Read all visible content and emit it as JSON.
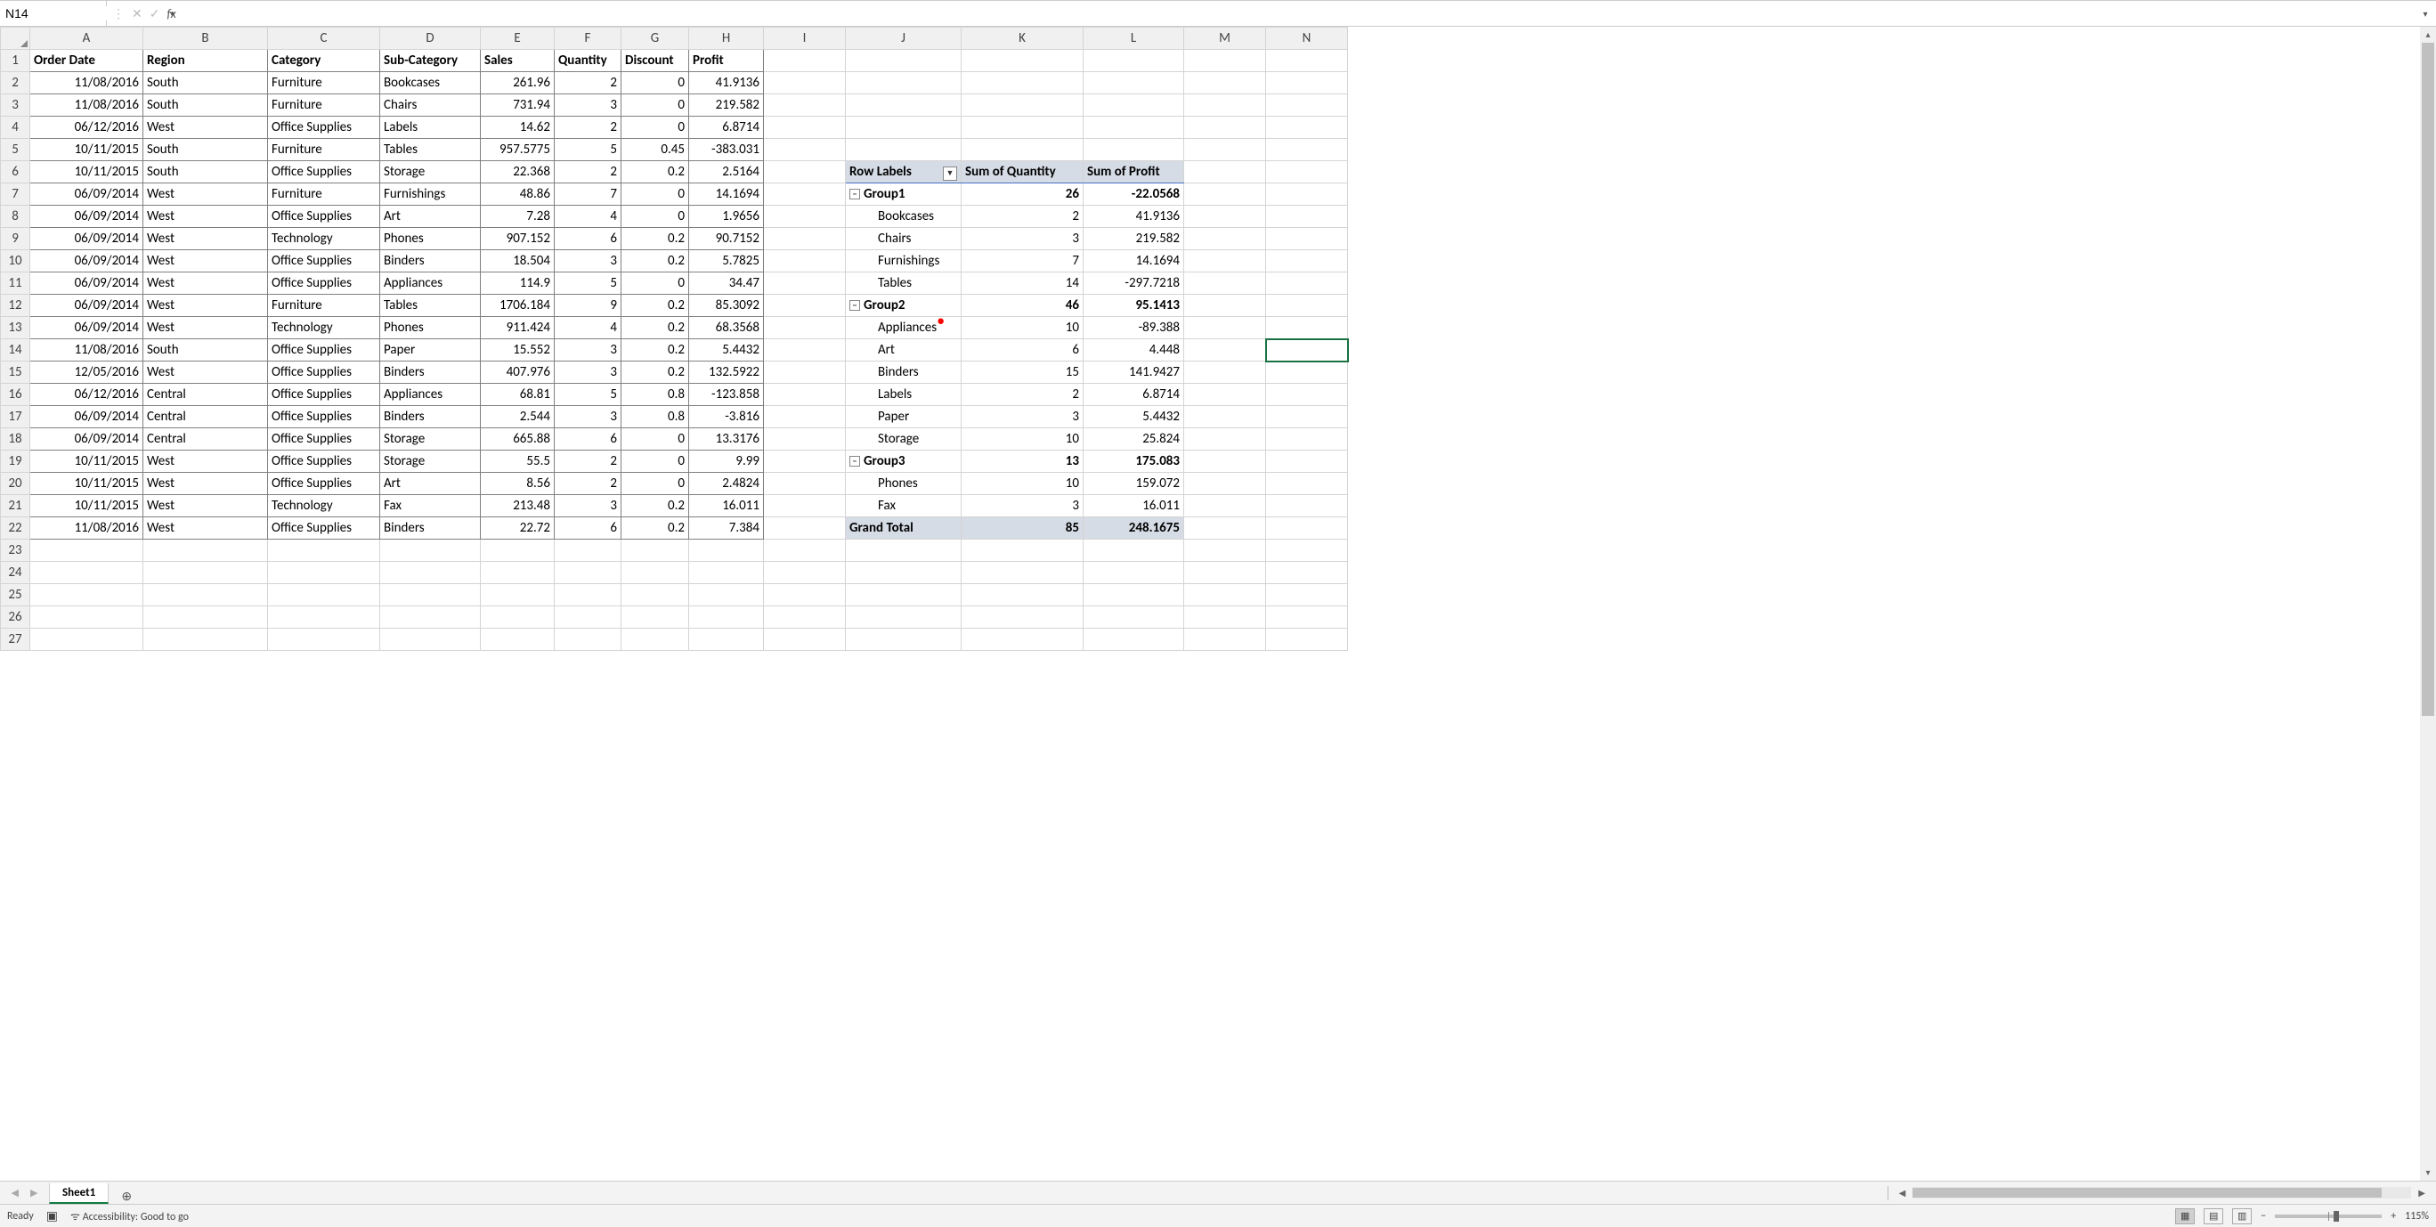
{
  "nameBox": {
    "value": "N14"
  },
  "formulaBar": {
    "value": "",
    "fxLabel": "fx"
  },
  "columns": [
    "A",
    "B",
    "C",
    "D",
    "E",
    "F",
    "G",
    "H",
    "I",
    "J",
    "K",
    "L",
    "M",
    "N"
  ],
  "rowCount": 27,
  "selectedCell": "N14",
  "dataHeaders": [
    "Order Date",
    "Region",
    "Category",
    "Sub-Category",
    "Sales",
    "Quantity",
    "Discount",
    "Profit"
  ],
  "dataRows": [
    [
      "11/08/2016",
      "South",
      "Furniture",
      "Bookcases",
      "261.96",
      "2",
      "0",
      "41.9136"
    ],
    [
      "11/08/2016",
      "South",
      "Furniture",
      "Chairs",
      "731.94",
      "3",
      "0",
      "219.582"
    ],
    [
      "06/12/2016",
      "West",
      "Office Supplies",
      "Labels",
      "14.62",
      "2",
      "0",
      "6.8714"
    ],
    [
      "10/11/2015",
      "South",
      "Furniture",
      "Tables",
      "957.5775",
      "5",
      "0.45",
      "-383.031"
    ],
    [
      "10/11/2015",
      "South",
      "Office Supplies",
      "Storage",
      "22.368",
      "2",
      "0.2",
      "2.5164"
    ],
    [
      "06/09/2014",
      "West",
      "Furniture",
      "Furnishings",
      "48.86",
      "7",
      "0",
      "14.1694"
    ],
    [
      "06/09/2014",
      "West",
      "Office Supplies",
      "Art",
      "7.28",
      "4",
      "0",
      "1.9656"
    ],
    [
      "06/09/2014",
      "West",
      "Technology",
      "Phones",
      "907.152",
      "6",
      "0.2",
      "90.7152"
    ],
    [
      "06/09/2014",
      "West",
      "Office Supplies",
      "Binders",
      "18.504",
      "3",
      "0.2",
      "5.7825"
    ],
    [
      "06/09/2014",
      "West",
      "Office Supplies",
      "Appliances",
      "114.9",
      "5",
      "0",
      "34.47"
    ],
    [
      "06/09/2014",
      "West",
      "Furniture",
      "Tables",
      "1706.184",
      "9",
      "0.2",
      "85.3092"
    ],
    [
      "06/09/2014",
      "West",
      "Technology",
      "Phones",
      "911.424",
      "4",
      "0.2",
      "68.3568"
    ],
    [
      "11/08/2016",
      "South",
      "Office Supplies",
      "Paper",
      "15.552",
      "3",
      "0.2",
      "5.4432"
    ],
    [
      "12/05/2016",
      "West",
      "Office Supplies",
      "Binders",
      "407.976",
      "3",
      "0.2",
      "132.5922"
    ],
    [
      "06/12/2016",
      "Central",
      "Office Supplies",
      "Appliances",
      "68.81",
      "5",
      "0.8",
      "-123.858"
    ],
    [
      "06/09/2014",
      "Central",
      "Office Supplies",
      "Binders",
      "2.544",
      "3",
      "0.8",
      "-3.816"
    ],
    [
      "06/09/2014",
      "Central",
      "Office Supplies",
      "Storage",
      "665.88",
      "6",
      "0",
      "13.3176"
    ],
    [
      "10/11/2015",
      "West",
      "Office Supplies",
      "Storage",
      "55.5",
      "2",
      "0",
      "9.99"
    ],
    [
      "10/11/2015",
      "West",
      "Office Supplies",
      "Art",
      "8.56",
      "2",
      "0",
      "2.4824"
    ],
    [
      "10/11/2015",
      "West",
      "Technology",
      "Fax",
      "213.48",
      "3",
      "0.2",
      "16.011"
    ],
    [
      "11/08/2016",
      "West",
      "Office Supplies",
      "Binders",
      "22.72",
      "6",
      "0.2",
      "7.384"
    ]
  ],
  "pivot": {
    "headers": [
      "Row Labels",
      "Sum of Quantity",
      "Sum of Profit"
    ],
    "rows": [
      {
        "type": "group",
        "label": "Group1",
        "qty": "26",
        "profit": "-22.0568"
      },
      {
        "type": "item",
        "label": "Bookcases",
        "qty": "2",
        "profit": "41.9136"
      },
      {
        "type": "item",
        "label": "Chairs",
        "qty": "3",
        "profit": "219.582"
      },
      {
        "type": "item",
        "label": "Furnishings",
        "qty": "7",
        "profit": "14.1694"
      },
      {
        "type": "item",
        "label": "Tables",
        "qty": "14",
        "profit": "-297.7218"
      },
      {
        "type": "group",
        "label": "Group2",
        "qty": "46",
        "profit": "95.1413"
      },
      {
        "type": "item",
        "label": "Appliances",
        "qty": "10",
        "profit": "-89.388",
        "mark": true
      },
      {
        "type": "item",
        "label": "Art",
        "qty": "6",
        "profit": "4.448"
      },
      {
        "type": "item",
        "label": "Binders",
        "qty": "15",
        "profit": "141.9427"
      },
      {
        "type": "item",
        "label": "Labels",
        "qty": "2",
        "profit": "6.8714"
      },
      {
        "type": "item",
        "label": "Paper",
        "qty": "3",
        "profit": "5.4432"
      },
      {
        "type": "item",
        "label": "Storage",
        "qty": "10",
        "profit": "25.824"
      },
      {
        "type": "group",
        "label": "Group3",
        "qty": "13",
        "profit": "175.083"
      },
      {
        "type": "item",
        "label": "Phones",
        "qty": "10",
        "profit": "159.072"
      },
      {
        "type": "item",
        "label": "Fax",
        "qty": "3",
        "profit": "16.011"
      }
    ],
    "grandTotal": {
      "label": "Grand Total",
      "qty": "85",
      "profit": "248.1675"
    }
  },
  "sheetTabs": {
    "active": "Sheet1"
  },
  "statusBar": {
    "ready": "Ready",
    "accessibility": "Accessibility: Good to go",
    "zoom": "115%"
  }
}
